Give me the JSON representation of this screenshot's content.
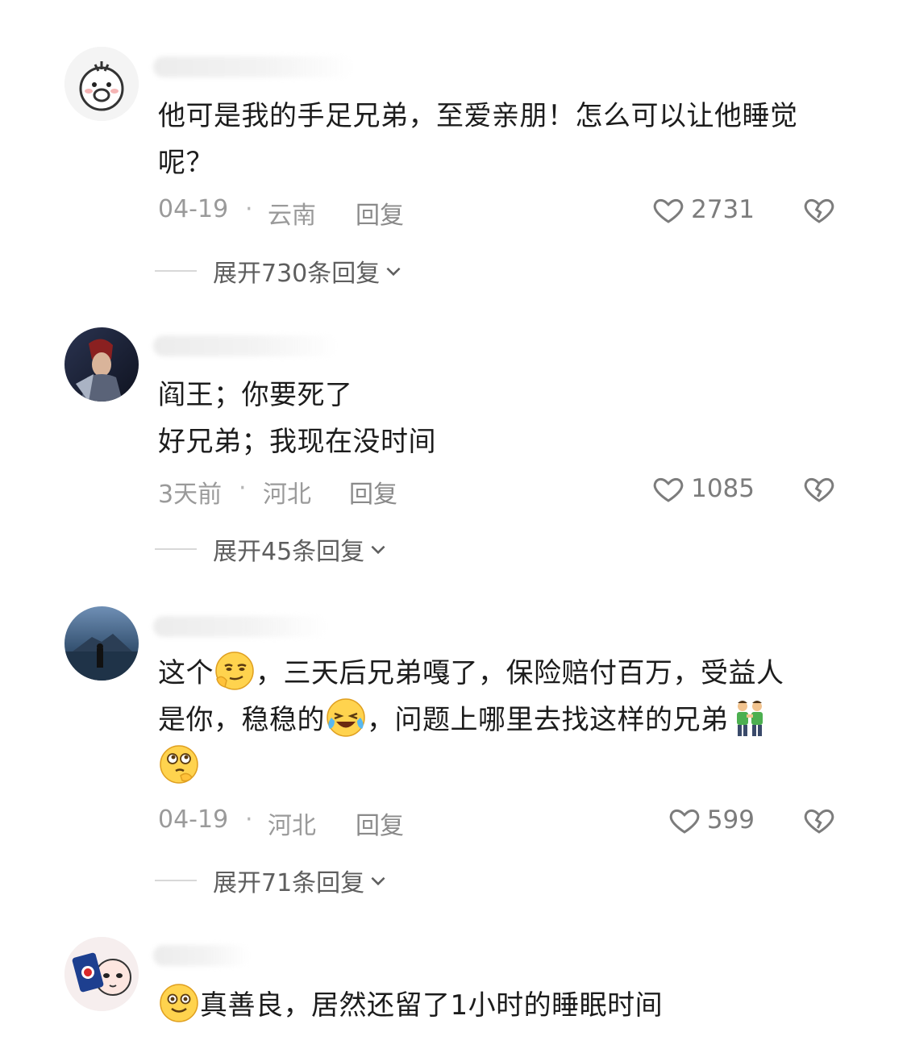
{
  "comments": [
    {
      "avatar_icon": "cartoon-face-icon",
      "lines": [
        "他可是我的手足兄弟，至爱亲朋！怎么可以让他睡觉",
        "呢？"
      ],
      "date": "04-19",
      "location": "云南",
      "reply_label": "回复",
      "likes": "2731",
      "expand_label": "展开730条回复"
    },
    {
      "avatar_icon": "game-character-icon",
      "lines": [
        "阎王；你要死了",
        "好兄弟；我现在没时间"
      ],
      "date": "3天前",
      "location": "河北",
      "reply_label": "回复",
      "likes": "1085",
      "expand_label": "展开45条回复"
    },
    {
      "avatar_icon": "night-scenery-icon",
      "line1_a": "这个",
      "line1_b": "，三天后兄弟嘎了，保险赔付百万，受益人",
      "line2_a": "是你，稳稳的",
      "line2_b": "，问题上哪里去找这样的兄弟",
      "emojis": [
        "smirk-emoji-icon",
        "laugh-cry-emoji-icon",
        "two-men-emoji-icon",
        "pondering-emoji-icon"
      ],
      "date": "04-19",
      "location": "河北",
      "reply_label": "回复",
      "likes": "599",
      "expand_label": "展开71条回复"
    },
    {
      "avatar_icon": "cartoon-drink-icon",
      "line1": "真善良，居然还留了1小时的睡眠时间",
      "emojis": [
        "smile-emoji-icon"
      ]
    }
  ],
  "separator": "·",
  "colors": {
    "text": "#1c1c1c",
    "meta": "#9a9a9a",
    "expand": "#5e5e5e"
  }
}
